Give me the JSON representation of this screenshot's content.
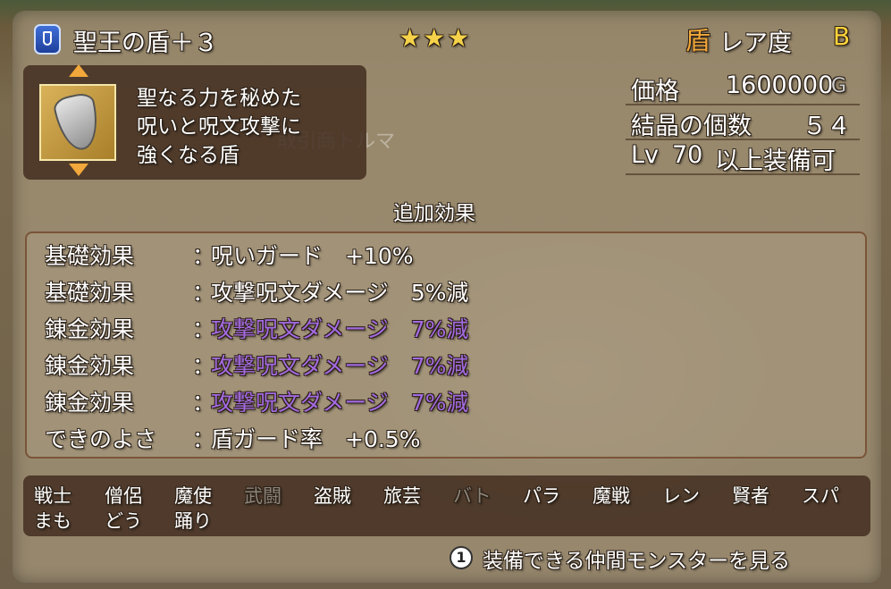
{
  "header": {
    "item_name": "聖王の盾＋３",
    "stars": "★★★",
    "rarity_icon": "盾",
    "rarity_label": "レア度",
    "rarity_value": "B"
  },
  "description": {
    "lines": [
      "聖なる力を秘めた",
      "呪いと呪文攻撃に",
      "強くなる盾"
    ],
    "icon": "shield-icon"
  },
  "background_text": "取引商トルマ",
  "stats": {
    "price_label": "価格",
    "price_value": "1600000",
    "price_unit": "G",
    "crystal_label": "結晶の個数",
    "crystal_value": "５４",
    "level_prefix": "Lv",
    "level_value": "70",
    "level_suffix": "以上装備可"
  },
  "effects_header": "追加効果",
  "effects": [
    {
      "label": "基礎効果",
      "value": "呪いガード　+10%",
      "alchemy": false
    },
    {
      "label": "基礎効果",
      "value": "攻撃呪文ダメージ　5%減",
      "alchemy": false
    },
    {
      "label": "錬金効果",
      "value": "攻撃呪文ダメージ　7%減",
      "alchemy": true
    },
    {
      "label": "錬金効果",
      "value": "攻撃呪文ダメージ　7%減",
      "alchemy": true
    },
    {
      "label": "錬金効果",
      "value": "攻撃呪文ダメージ　7%減",
      "alchemy": true
    },
    {
      "label": "できのよさ",
      "value": "盾ガード率　+0.5%",
      "alchemy": false
    }
  ],
  "effect_colon": "：",
  "jobs": {
    "row1": [
      {
        "name": "戦士",
        "enabled": true
      },
      {
        "name": "僧侶",
        "enabled": true
      },
      {
        "name": "魔使",
        "enabled": true
      },
      {
        "name": "武闘",
        "enabled": false
      },
      {
        "name": "盗賊",
        "enabled": true
      },
      {
        "name": "旅芸",
        "enabled": true
      },
      {
        "name": "バト",
        "enabled": false
      },
      {
        "name": "パラ",
        "enabled": true
      },
      {
        "name": "魔戦",
        "enabled": true
      },
      {
        "name": "レン",
        "enabled": true
      },
      {
        "name": "賢者",
        "enabled": true
      },
      {
        "name": "スパ",
        "enabled": true
      }
    ],
    "row2": [
      {
        "name": "まも",
        "enabled": true
      },
      {
        "name": "どう",
        "enabled": true
      },
      {
        "name": "踊り",
        "enabled": true
      }
    ]
  },
  "footer": {
    "button_number": "1",
    "label": "装備できる仲間モンスターを見る"
  },
  "colors": {
    "alchemy_purple": "#a36ae0",
    "star_yellow": "#f6d24a",
    "rarity_orange": "#f2a83a",
    "disabled_gray": "#8c8478"
  }
}
